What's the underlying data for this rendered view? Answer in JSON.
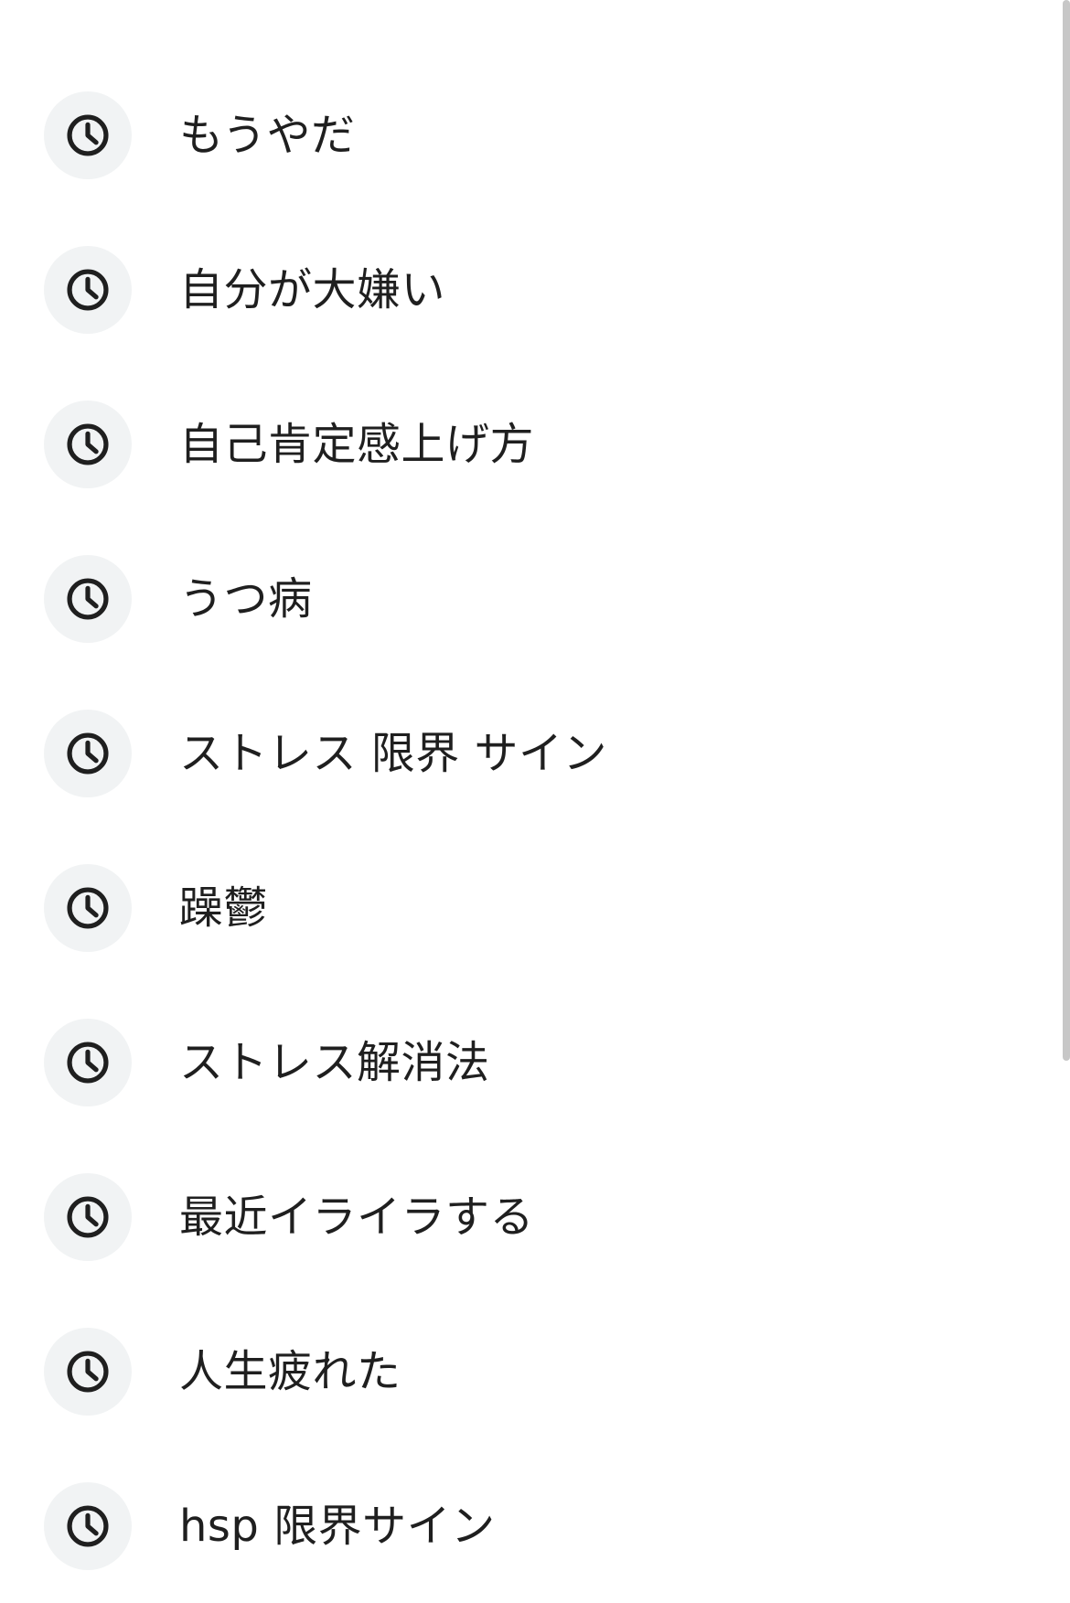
{
  "history": {
    "item_icon": "clock-icon",
    "items": [
      {
        "label": "もうやだ"
      },
      {
        "label": "自分が大嫌い"
      },
      {
        "label": "自己肯定感上げ方"
      },
      {
        "label": "うつ病"
      },
      {
        "label": "ストレス 限界 サイン"
      },
      {
        "label": "躁鬱"
      },
      {
        "label": "ストレス解消法"
      },
      {
        "label": "最近イライラする"
      },
      {
        "label": "人生疲れた"
      },
      {
        "label": "hsp 限界サイン"
      }
    ]
  },
  "colors": {
    "icon_background": "#f1f3f4",
    "icon_stroke": "#1f1f1f",
    "text": "#1f1f1f",
    "scrollbar": "#c7c7c7"
  }
}
